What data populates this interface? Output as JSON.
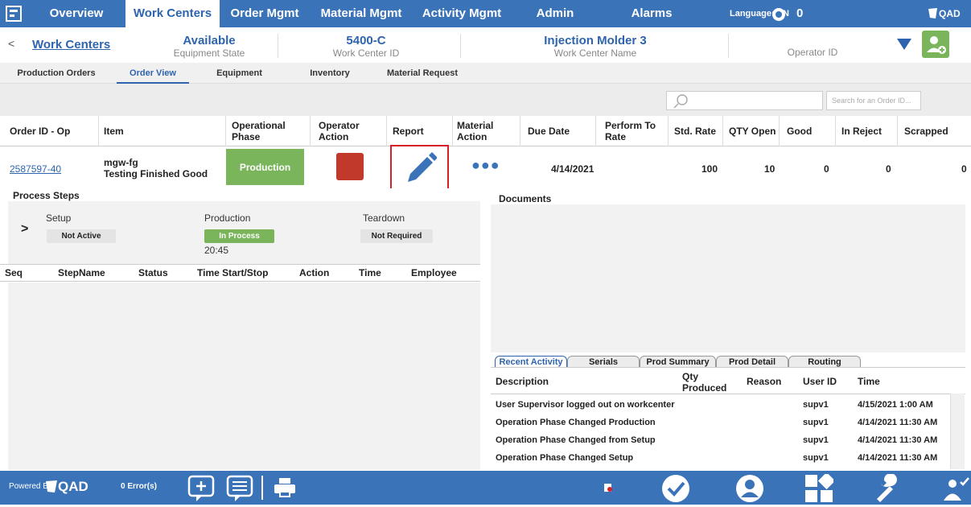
{
  "nav": {
    "tabs": [
      {
        "label": "Overview"
      },
      {
        "label": "Work Centers"
      },
      {
        "label": "Order Mgmt"
      },
      {
        "label": "Material Mgmt"
      },
      {
        "label": "Activity Mgmt"
      },
      {
        "label": "Admin"
      },
      {
        "label": "Alarms"
      }
    ],
    "language_label": "Language:",
    "language_value": "EN",
    "alarm_count": "0",
    "brand": "QAD"
  },
  "header": {
    "back_label": "Work Centers",
    "equipment_state_value": "Available",
    "equipment_state_label": "Equipment State",
    "work_center_id_value": "5400-C",
    "work_center_id_label": "Work Center ID",
    "work_center_name_value": "Injection Molder 3",
    "work_center_name_label": "Work Center Name",
    "operator_id_label": "Operator ID"
  },
  "subtabs": [
    {
      "label": "Production Orders"
    },
    {
      "label": "Order View"
    },
    {
      "label": "Equipment"
    },
    {
      "label": "Inventory"
    },
    {
      "label": "Material Request"
    }
  ],
  "search": {
    "placeholder": "Search for an Order ID..."
  },
  "table": {
    "columns": [
      "Order ID - Op",
      "Item",
      "Operational Phase",
      "Operator Action",
      "Report",
      "Material Action",
      "Due Date",
      "Perform To Rate",
      "Std. Rate",
      "QTY Open",
      "Good",
      "In Reject",
      "Scrapped"
    ],
    "row": {
      "order_id": "2587597-40",
      "item_code": "mgw-fg",
      "item_desc": "Testing Finished Good",
      "phase": "Production",
      "due_date": "4/14/2021",
      "std_rate": "100",
      "qty_open": "10",
      "good": "0",
      "in_reject": "0",
      "scrapped": "0"
    }
  },
  "process_steps": {
    "title": "Process Steps",
    "steps": [
      {
        "name": "Setup",
        "status": "Not Active"
      },
      {
        "name": "Production",
        "status": "In Process",
        "time": "20:45"
      },
      {
        "name": "Teardown",
        "status": "Not Required"
      }
    ],
    "columns": [
      "Seq",
      "StepName",
      "Status",
      "Time Start/Stop",
      "Action",
      "Time",
      "Employee"
    ]
  },
  "documents": {
    "title": "Documents",
    "tabs": [
      {
        "label": "Recent Activity"
      },
      {
        "label": "Serials"
      },
      {
        "label": "Prod Summary"
      },
      {
        "label": "Prod Detail"
      },
      {
        "label": "Routing"
      }
    ],
    "columns": [
      "Description",
      "Qty Produced",
      "Reason",
      "User ID",
      "Time"
    ],
    "rows": [
      {
        "desc": "User Supervisor logged out on workcenter",
        "user": "supv1",
        "time": "4/15/2021 1:00 AM"
      },
      {
        "desc": "Operation Phase Changed Production",
        "user": "supv1",
        "time": "4/14/2021 11:30 AM"
      },
      {
        "desc": "Operation Phase Changed from Setup",
        "user": "supv1",
        "time": "4/14/2021 11:30 AM"
      },
      {
        "desc": "Operation Phase Changed Setup",
        "user": "supv1",
        "time": "4/14/2021 11:30 AM"
      }
    ]
  },
  "footer": {
    "powered_by": "Powered By",
    "brand": "QAD",
    "errors": "0 Error(s)"
  },
  "colors": {
    "nav": "#3b73b9",
    "phase": "#7ab55c",
    "operator_action": "#c0392b",
    "report_highlight": "#d81f26"
  }
}
